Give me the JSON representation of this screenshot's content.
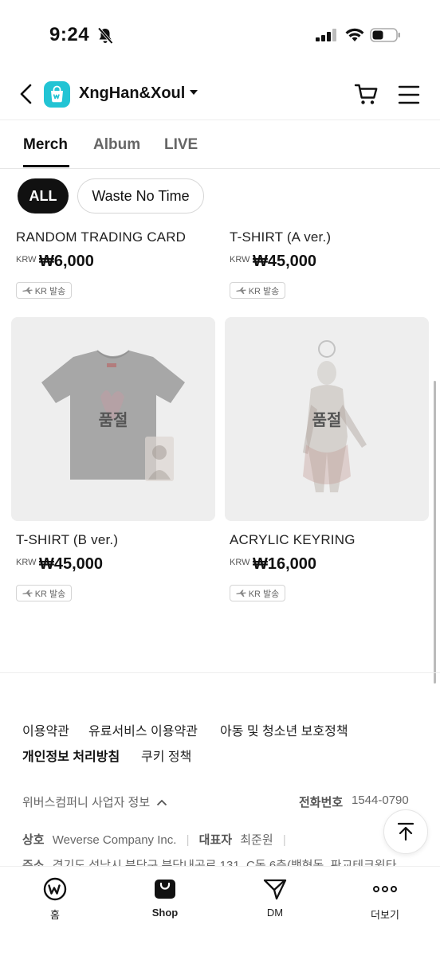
{
  "status_bar": {
    "time": "9:24"
  },
  "header": {
    "artist_name": "XngHan&Xoul"
  },
  "tabs": [
    {
      "label": "Merch",
      "active": true
    },
    {
      "label": "Album",
      "active": false
    },
    {
      "label": "LIVE",
      "active": false
    }
  ],
  "filters": [
    {
      "label": "ALL",
      "selected": true
    },
    {
      "label": "Waste No Time",
      "selected": false
    }
  ],
  "products": [
    {
      "name": "RANDOM TRADING CARD",
      "currency": "KRW",
      "price": "₩6,000",
      "shipping": "KR 발송"
    },
    {
      "name": "T-SHIRT (A ver.)",
      "currency": "KRW",
      "price": "₩45,000",
      "shipping": "KR 발송"
    },
    {
      "name": "T-SHIRT (B ver.)",
      "currency": "KRW",
      "price": "₩45,000",
      "shipping": "KR 발송",
      "status": "품절"
    },
    {
      "name": "ACRYLIC KEYRING",
      "currency": "KRW",
      "price": "₩16,000",
      "shipping": "KR 발송",
      "status": "품절"
    }
  ],
  "footer": {
    "links": [
      "이용약관",
      "유료서비스 이용약관",
      "아동 및 청소년 보호정책",
      "개인정보 처리방침",
      "쿠키 정책"
    ],
    "company_info_toggle": "위버스컴퍼니 사업자 정보",
    "phone_label": "전화번호",
    "phone_value": "1544-0790",
    "trade_name_label": "상호",
    "trade_name": "Weverse Company Inc.",
    "ceo_label": "대표자",
    "ceo": "최준원",
    "address_label": "주소",
    "address": "경기도 성남시 분당구 분당내곡로 131, C동 6층(백현동, 판교테크원타"
  },
  "bottom_nav": [
    {
      "label": "홈",
      "active": false
    },
    {
      "label": "Shop",
      "active": true
    },
    {
      "label": "DM",
      "active": false
    },
    {
      "label": "더보기",
      "active": false
    }
  ],
  "colors": {
    "brand_cyan": "#22c4d4",
    "text": "#111111",
    "chip_active_bg": "#111111"
  }
}
